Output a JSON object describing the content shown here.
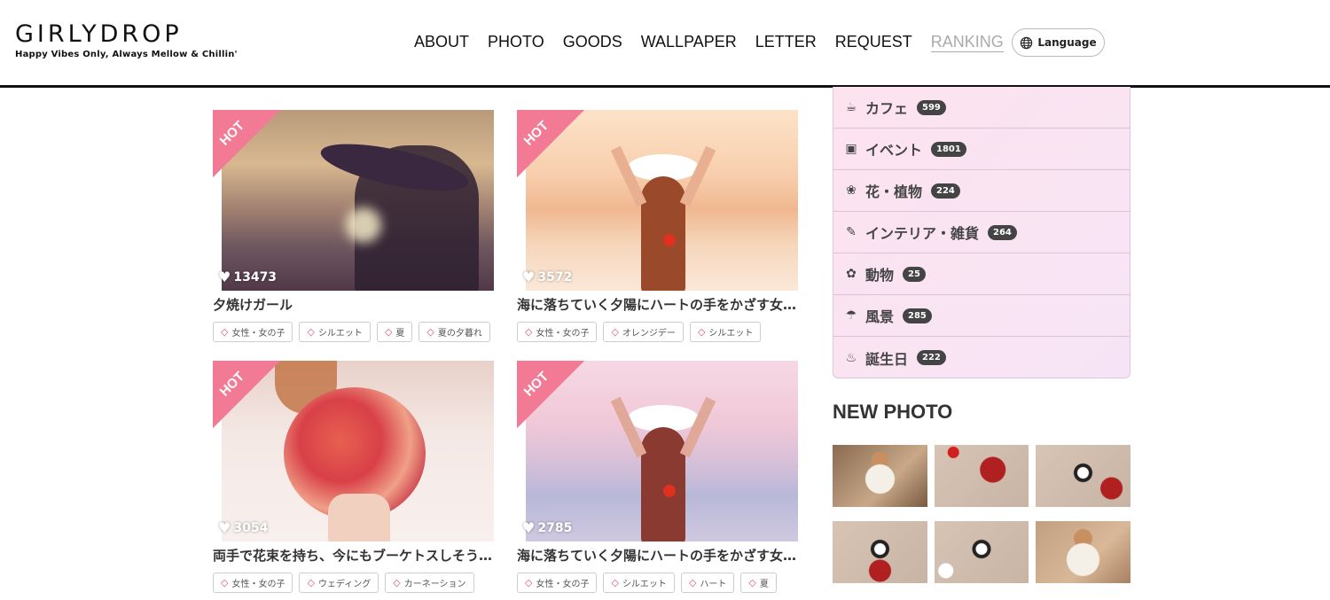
{
  "logo": {
    "main": "GIRLYDROP",
    "tagline": "Happy Vibes Only, Always Mellow & Chillin'"
  },
  "nav": [
    "ABOUT",
    "PHOTO",
    "GOODS",
    "WALLPAPER",
    "LETTER",
    "REQUEST",
    "RANKING"
  ],
  "language_label": "Language",
  "hot_label": "HOT",
  "cards": [
    {
      "likes": "13473",
      "title": "夕焼けガール",
      "tags": [
        "女性・女の子",
        "シルエット",
        "夏",
        "夏の夕暮れ"
      ]
    },
    {
      "likes": "3572",
      "title": "海に落ちていく夕陽にハートの手をかざす女の子",
      "tags": [
        "女性・女の子",
        "オレンジデー",
        "シルエット"
      ]
    },
    {
      "likes": "3054",
      "title": "両手で花束を持ち、今にもブーケトスしそうな女性",
      "tags": [
        "女性・女の子",
        "ウェディング",
        "カーネーション"
      ]
    },
    {
      "likes": "2785",
      "title": "海に落ちていく夕陽にハートの手をかざす女の子",
      "tags": [
        "女性・女の子",
        "シルエット",
        "ハート",
        "夏"
      ]
    }
  ],
  "categories": [
    {
      "icon": "coffee-icon",
      "label": "カフェ",
      "count": "599"
    },
    {
      "icon": "gift-icon",
      "label": "イベント",
      "count": "1801"
    },
    {
      "icon": "lotus-icon",
      "label": "花・植物",
      "count": "224"
    },
    {
      "icon": "wand-icon",
      "label": "インテリア・雑貨",
      "count": "264"
    },
    {
      "icon": "paw-icon",
      "label": "動物",
      "count": "25"
    },
    {
      "icon": "umbrella-beach-icon",
      "label": "風景",
      "count": "285"
    },
    {
      "icon": "birthday-cake-icon",
      "label": "誕生日",
      "count": "222"
    }
  ],
  "new_photo_title": "NEW PHOTO",
  "colors": {
    "hot_ribbon": "#f27a94",
    "count_badge": "#444444",
    "sidebar_bg": "#fbe4f0"
  }
}
